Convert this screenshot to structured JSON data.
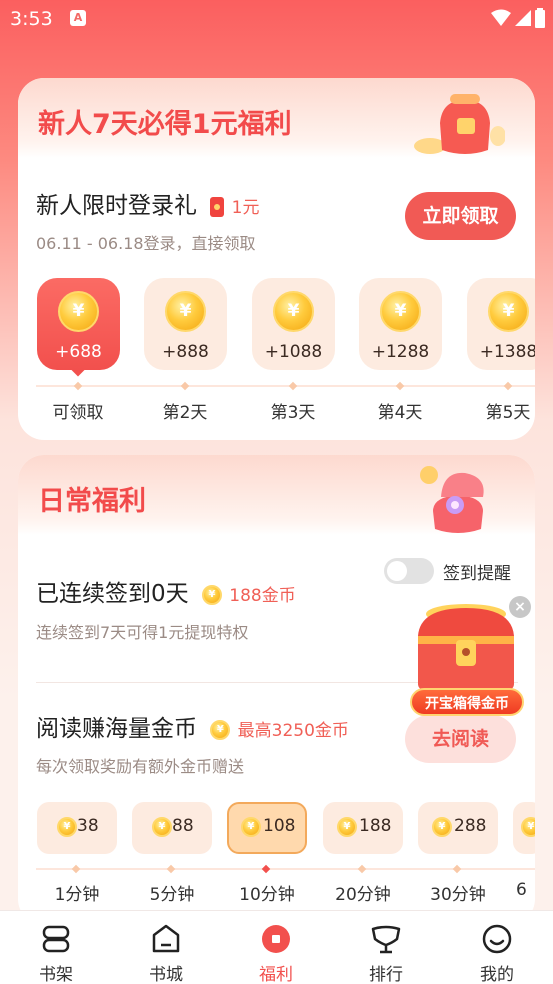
{
  "status": {
    "time": "3:53"
  },
  "newbie": {
    "title": "新人7天必得1元福利",
    "login_title": "新人限时登录礼",
    "reward": "1元",
    "desc": "06.11 - 06.18登录，直接领取",
    "claim_button": "立即领取",
    "days": [
      {
        "amount": "+688",
        "label": "可领取",
        "active": true
      },
      {
        "amount": "+888",
        "label": "第2天",
        "active": false
      },
      {
        "amount": "+1088",
        "label": "第3天",
        "active": false
      },
      {
        "amount": "+1288",
        "label": "第4天",
        "active": false
      },
      {
        "amount": "+1388",
        "label": "第5天",
        "active": false
      }
    ],
    "coin_symbol": "¥"
  },
  "daily": {
    "title": "日常福利",
    "reminder_label": "签到提醒",
    "reminder_on": false,
    "checkin_title": "已连续签到0天",
    "checkin_reward": "188金币",
    "checkin_desc": "连续签到7天可得1元提现特权",
    "read_title": "阅读赚海量金币",
    "read_reward": "最高3250金币",
    "read_desc": "每次领取奖励有额外金币赠送",
    "read_button": "去阅读",
    "minutes": [
      {
        "value": "38",
        "label": "1分钟"
      },
      {
        "value": "88",
        "label": "5分钟"
      },
      {
        "value": "108",
        "label": "10分钟",
        "active": true
      },
      {
        "value": "188",
        "label": "20分钟"
      },
      {
        "value": "288",
        "label": "30分钟"
      },
      {
        "value": "",
        "label": "6"
      }
    ]
  },
  "float_chest": {
    "label": "开宝箱得金币",
    "close": "×"
  },
  "nav": [
    {
      "label": "书架",
      "icon": "bookshelf-icon"
    },
    {
      "label": "书城",
      "icon": "bookstore-icon"
    },
    {
      "label": "福利",
      "icon": "welfare-icon",
      "active": true
    },
    {
      "label": "排行",
      "icon": "ranking-icon"
    },
    {
      "label": "我的",
      "icon": "profile-icon"
    }
  ],
  "colors": {
    "accent": "#f2504d",
    "coin": "#ffcb3d",
    "tile": "#fdebe0"
  }
}
